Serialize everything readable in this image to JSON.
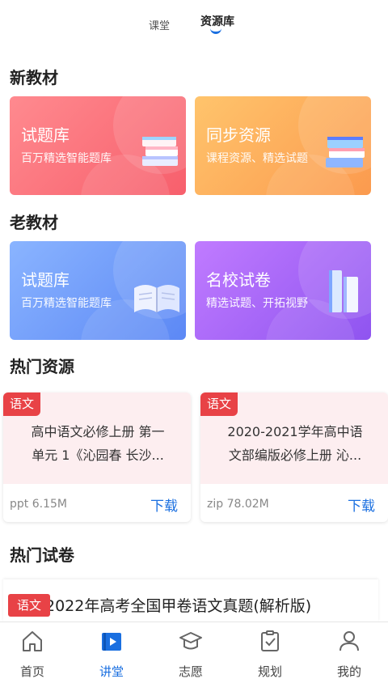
{
  "top_tabs": {
    "tab1": "课堂",
    "tab2": "资源库"
  },
  "sections": {
    "new_materials": "新教材",
    "old_materials": "老教材",
    "hot_resources": "热门资源",
    "hot_papers": "热门试卷"
  },
  "cards": {
    "new_question_bank": {
      "title": "试题库",
      "subtitle": "百万精选智能题库"
    },
    "sync_resources": {
      "title": "同步资源",
      "subtitle": "课程资源、精选试题"
    },
    "old_question_bank": {
      "title": "试题库",
      "subtitle": "百万精选智能题库"
    },
    "famous_school_papers": {
      "title": "名校试卷",
      "subtitle": "精选试题、开拓视野"
    }
  },
  "resources": [
    {
      "subject": "语文",
      "title_line1": "高中语文必修上册 第一",
      "title_line2": "单元 1《沁园春 长沙...",
      "file_type": "ppt",
      "file_size": "6.15M",
      "download_label": "下载"
    },
    {
      "subject": "语文",
      "title_line1": "2020-2021学年高中语",
      "title_line2": "文部编版必修上册 沁...",
      "file_type": "zip",
      "file_size": "78.02M",
      "download_label": "下载"
    }
  ],
  "paper": {
    "subject": "语文",
    "title": "2022年高考全国甲卷语文真题(解析版)"
  },
  "bottom_nav": [
    {
      "label": "首页",
      "icon": "home-icon"
    },
    {
      "label": "讲堂",
      "icon": "video-lecture-icon"
    },
    {
      "label": "志愿",
      "icon": "graduation-cap-icon"
    },
    {
      "label": "规划",
      "icon": "clipboard-check-icon"
    },
    {
      "label": "我的",
      "icon": "user-icon"
    }
  ],
  "colors": {
    "accent": "#1a6fe0",
    "badge": "#e84246"
  }
}
